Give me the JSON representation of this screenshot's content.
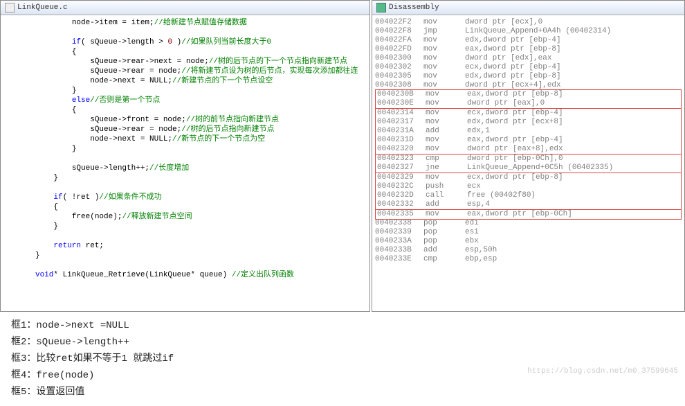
{
  "srcTitle": "LinkQueue.c",
  "disTitle": "Disassembly",
  "code": [
    {
      "i": 2,
      "t": "blk",
      "s": [
        {
          "k": "n",
          "v": "node->item = item;"
        },
        {
          "k": "c",
          "v": "//给新建节点赋值存储数据"
        }
      ]
    },
    {
      "t": "blank"
    },
    {
      "i": 2,
      "t": "blk",
      "s": [
        {
          "k": "k",
          "v": "if"
        },
        {
          "k": "n",
          "v": "( sQueue->length > "
        },
        {
          "k": "num",
          "v": "0"
        },
        {
          "k": "n",
          "v": " )"
        },
        {
          "k": "c",
          "v": "//如果队列当前长度大于0"
        }
      ]
    },
    {
      "i": 2,
      "t": "blk",
      "s": [
        {
          "k": "n",
          "v": "{"
        }
      ]
    },
    {
      "i": 3,
      "t": "blk",
      "s": [
        {
          "k": "n",
          "v": "sQueue->rear->next = node;"
        },
        {
          "k": "c",
          "v": "//树的后节点的下一个节点指向新建节点"
        }
      ]
    },
    {
      "i": 3,
      "t": "blk",
      "s": [
        {
          "k": "n",
          "v": "sQueue->rear = node;"
        },
        {
          "k": "c",
          "v": "//将新建节点设为树的后节点，实现每次添加都往连"
        }
      ]
    },
    {
      "i": 3,
      "t": "blk",
      "s": [
        {
          "k": "n",
          "v": "node->next = NULL;"
        },
        {
          "k": "c",
          "v": "//新建节点的下一个节点设空"
        }
      ]
    },
    {
      "i": 2,
      "t": "blk",
      "s": [
        {
          "k": "n",
          "v": "}"
        }
      ]
    },
    {
      "i": 2,
      "t": "blk",
      "s": [
        {
          "k": "k",
          "v": "else"
        },
        {
          "k": "c",
          "v": "//否则是第一个节点"
        }
      ]
    },
    {
      "i": 2,
      "t": "blk",
      "s": [
        {
          "k": "n",
          "v": "{"
        }
      ]
    },
    {
      "i": 3,
      "t": "blk",
      "s": [
        {
          "k": "n",
          "v": "sQueue->front = node;"
        },
        {
          "k": "c",
          "v": "//树的前节点指向新建节点"
        }
      ]
    },
    {
      "i": 3,
      "t": "blk",
      "s": [
        {
          "k": "n",
          "v": "sQueue->rear = node;"
        },
        {
          "k": "c",
          "v": "//树的后节点指向新建节点"
        }
      ]
    },
    {
      "i": 3,
      "t": "blk",
      "s": [
        {
          "k": "n",
          "v": "node->next = NULL;"
        },
        {
          "k": "c",
          "v": "//新节点的下一个节点为空"
        }
      ]
    },
    {
      "i": 2,
      "t": "blk",
      "s": [
        {
          "k": "n",
          "v": "}"
        }
      ]
    },
    {
      "t": "blank"
    },
    {
      "i": 2,
      "t": "blk",
      "s": [
        {
          "k": "n",
          "v": "sQueue->length++;"
        },
        {
          "k": "c",
          "v": "//长度增加"
        }
      ]
    },
    {
      "i": 1,
      "t": "blk",
      "s": [
        {
          "k": "n",
          "v": "}"
        }
      ]
    },
    {
      "t": "blank"
    },
    {
      "i": 1,
      "t": "blk",
      "s": [
        {
          "k": "k",
          "v": "if"
        },
        {
          "k": "n",
          "v": "( !ret )"
        },
        {
          "k": "c",
          "v": "//如果条件不成功"
        }
      ]
    },
    {
      "i": 1,
      "t": "blk",
      "s": [
        {
          "k": "n",
          "v": "{"
        }
      ]
    },
    {
      "i": 2,
      "t": "blk",
      "s": [
        {
          "k": "n",
          "v": "free(node);"
        },
        {
          "k": "c",
          "v": "//释放新建节点空间"
        }
      ]
    },
    {
      "i": 1,
      "t": "blk",
      "s": [
        {
          "k": "n",
          "v": "}"
        }
      ]
    },
    {
      "t": "blank"
    },
    {
      "i": 1,
      "t": "blk",
      "s": [
        {
          "k": "k",
          "v": "return"
        },
        {
          "k": "n",
          "v": " ret;"
        }
      ]
    },
    {
      "i": 0,
      "t": "blk",
      "s": [
        {
          "k": "n",
          "v": "}"
        }
      ]
    },
    {
      "t": "blank"
    },
    {
      "i": 0,
      "t": "blk",
      "s": [
        {
          "k": "k",
          "v": "void"
        },
        {
          "k": "n",
          "v": "* LinkQueue_Retrieve(LinkQueue* queue) "
        },
        {
          "k": "c",
          "v": "//定义出队列函数"
        }
      ]
    }
  ],
  "asm": [
    {
      "a": "004022F2",
      "o": "mov",
      "r": "dword ptr [ecx],0"
    },
    {
      "a": "004022F8",
      "o": "jmp",
      "r": "LinkQueue_Append+0A4h (00402314)"
    },
    {
      "a": "004022FA",
      "o": "mov",
      "r": "edx,dword ptr [ebp-4]"
    },
    {
      "a": "004022FD",
      "o": "mov",
      "r": "eax,dword ptr [ebp-8]"
    },
    {
      "a": "00402300",
      "o": "mov",
      "r": "dword ptr [edx],eax"
    },
    {
      "a": "00402302",
      "o": "mov",
      "r": "ecx,dword ptr [ebp-4]"
    },
    {
      "a": "00402305",
      "o": "mov",
      "r": "edx,dword ptr [ebp-8]"
    },
    {
      "a": "00402308",
      "o": "mov",
      "r": "dword ptr [ecx+4],edx"
    },
    {
      "a": "0040230B",
      "o": "mov",
      "r": "eax,dword ptr [ebp-8]",
      "box": 1
    },
    {
      "a": "0040230E",
      "o": "mov",
      "r": "dword ptr [eax],0",
      "box": 1
    },
    {
      "a": "00402314",
      "o": "mov",
      "r": "ecx,dword ptr [ebp-4]",
      "box": 2
    },
    {
      "a": "00402317",
      "o": "mov",
      "r": "edx,dword ptr [ecx+8]",
      "box": 2
    },
    {
      "a": "0040231A",
      "o": "add",
      "r": "edx,1",
      "box": 2
    },
    {
      "a": "0040231D",
      "o": "mov",
      "r": "eax,dword ptr [ebp-4]",
      "box": 2
    },
    {
      "a": "00402320",
      "o": "mov",
      "r": "dword ptr [eax+8],edx",
      "box": 2
    },
    {
      "a": "00402323",
      "o": "cmp",
      "r": "dword ptr [ebp-0Ch],0",
      "box": 3
    },
    {
      "a": "00402327",
      "o": "jne",
      "r": "LinkQueue_Append+0C5h (00402335)",
      "box": 3
    },
    {
      "a": "00402329",
      "o": "mov",
      "r": "ecx,dword ptr [ebp-8]",
      "box": 4
    },
    {
      "a": "0040232C",
      "o": "push",
      "r": "ecx",
      "box": 4
    },
    {
      "a": "0040232D",
      "o": "call",
      "r": "free (00402f80)",
      "box": 4
    },
    {
      "a": "00402332",
      "o": "add",
      "r": "esp,4",
      "box": 4
    },
    {
      "a": "00402335",
      "o": "mov",
      "r": "eax,dword ptr [ebp-0Ch]",
      "box": 5
    },
    {
      "a": "00402338",
      "o": "pop",
      "r": "edi"
    },
    {
      "a": "00402339",
      "o": "pop",
      "r": "esi"
    },
    {
      "a": "0040233A",
      "o": "pop",
      "r": "ebx"
    },
    {
      "a": "0040233B",
      "o": "add",
      "r": "esp,50h"
    },
    {
      "a": "0040233E",
      "o": "cmp",
      "r": "ebp,esp"
    }
  ],
  "notes": [
    "框1：node->next =NULL",
    "框2：sQueue->length++",
    "框3：比较ret如果不等于1 就跳过if",
    "框4：free(node)",
    "框5：设置返回值"
  ],
  "watermark": "https://blog.csdn.net/m0_37599645"
}
